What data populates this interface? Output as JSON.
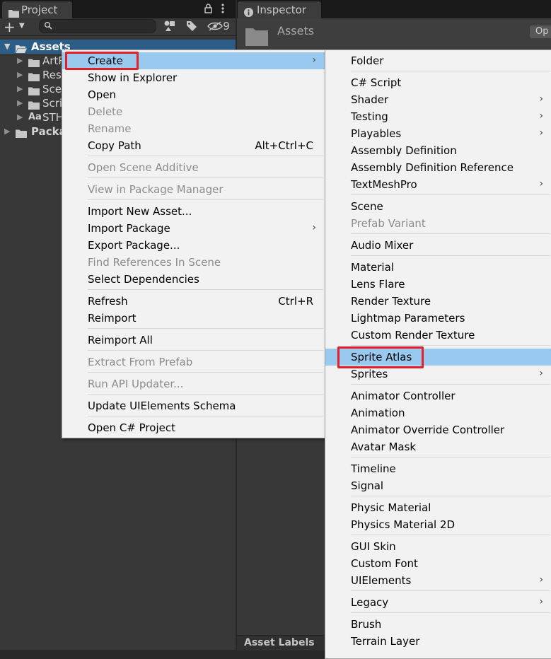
{
  "project_panel": {
    "tab_label": "Project",
    "hidden_count": "9",
    "tree": [
      {
        "label": "Assets",
        "selected": true
      },
      {
        "label": "ArtR"
      },
      {
        "label": "Res"
      },
      {
        "label": "Sce"
      },
      {
        "label": "Scri"
      },
      {
        "label": "STH"
      },
      {
        "label": "Packa"
      }
    ],
    "font_asset_glyph": "Aa"
  },
  "inspector": {
    "tab_label": "Inspector",
    "title": "Assets",
    "open_button": "Op",
    "asset_labels": "Asset Labels"
  },
  "context_menu": {
    "items": [
      {
        "label": "Create",
        "highlighted": true,
        "submenu": true
      },
      {
        "label": "Show in Explorer"
      },
      {
        "label": "Open"
      },
      {
        "label": "Delete",
        "disabled": true
      },
      {
        "label": "Rename",
        "disabled": true
      },
      {
        "label": "Copy Path",
        "shortcut": "Alt+Ctrl+C"
      },
      {
        "label": "Open Scene Additive",
        "disabled": true
      },
      {
        "label": "View in Package Manager",
        "disabled": true
      },
      {
        "label": "Import New Asset..."
      },
      {
        "label": "Import Package",
        "submenu": true
      },
      {
        "label": "Export Package..."
      },
      {
        "label": "Find References In Scene",
        "disabled": true
      },
      {
        "label": "Select Dependencies"
      },
      {
        "label": "Refresh",
        "shortcut": "Ctrl+R"
      },
      {
        "label": "Reimport"
      },
      {
        "label": "Reimport All"
      },
      {
        "label": "Extract From Prefab",
        "disabled": true
      },
      {
        "label": "Run API Updater...",
        "disabled": true
      },
      {
        "label": "Update UIElements Schema"
      },
      {
        "label": "Open C# Project"
      }
    ]
  },
  "create_submenu": {
    "items": [
      {
        "label": "Folder"
      },
      {
        "label": "C# Script"
      },
      {
        "label": "Shader",
        "submenu": true
      },
      {
        "label": "Testing",
        "submenu": true
      },
      {
        "label": "Playables",
        "submenu": true
      },
      {
        "label": "Assembly Definition"
      },
      {
        "label": "Assembly Definition Reference"
      },
      {
        "label": "TextMeshPro",
        "submenu": true
      },
      {
        "label": "Scene"
      },
      {
        "label": "Prefab Variant",
        "disabled": true
      },
      {
        "label": "Audio Mixer"
      },
      {
        "label": "Material"
      },
      {
        "label": "Lens Flare"
      },
      {
        "label": "Render Texture"
      },
      {
        "label": "Lightmap Parameters"
      },
      {
        "label": "Custom Render Texture"
      },
      {
        "label": "Sprite Atlas",
        "highlighted": true
      },
      {
        "label": "Sprites",
        "submenu": true
      },
      {
        "label": "Animator Controller"
      },
      {
        "label": "Animation"
      },
      {
        "label": "Animator Override Controller"
      },
      {
        "label": "Avatar Mask"
      },
      {
        "label": "Timeline"
      },
      {
        "label": "Signal"
      },
      {
        "label": "Physic Material"
      },
      {
        "label": "Physics Material 2D"
      },
      {
        "label": "GUI Skin"
      },
      {
        "label": "Custom Font"
      },
      {
        "label": "UIElements",
        "submenu": true
      },
      {
        "label": "Legacy",
        "submenu": true
      },
      {
        "label": "Brush"
      },
      {
        "label": "Terrain Layer"
      }
    ]
  },
  "colors": {
    "menu_highlight": "#99c9ef",
    "callout_red": "#e51d2b",
    "selection_blue": "#2c5d87"
  }
}
